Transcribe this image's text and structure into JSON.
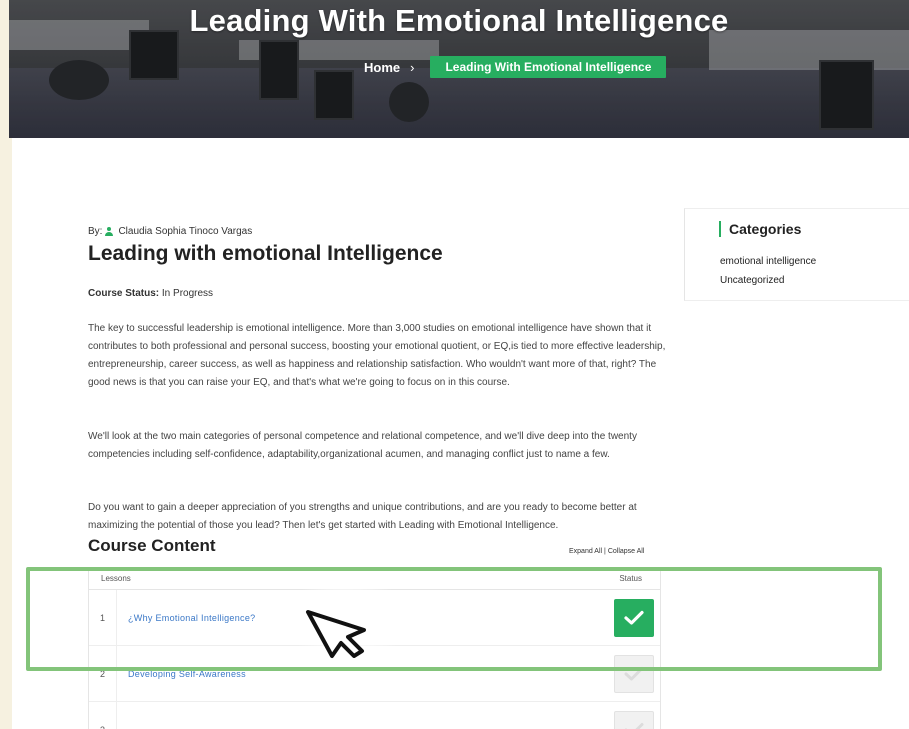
{
  "hero": {
    "title": "Leading With Emotional Intelligence",
    "breadcrumb": {
      "home": "Home",
      "separator": "›",
      "current": "Leading With Emotional Intelligence"
    }
  },
  "course": {
    "by_label": "By:",
    "author": "Claudia Sophia Tinoco Vargas",
    "title": "Leading with emotional Intelligence",
    "status_label": "Course Status:",
    "status_value": "In Progress",
    "paragraphs": [
      "The key to successful leadership is emotional intelligence. More than 3,000 studies on emotional intelligence have shown that it contributes to both professional and personal success, boosting your emotional quotient, or EQ,is tied to more effective leadership, entrepreneurship, career success, as well as happiness and relationship satisfaction. Who wouldn't want more of that, right? The good news is that you can raise your EQ, and that's what we're going to focus on in this course.",
      "We'll look at the two main categories of personal competence and relational competence, and we'll dive deep into the twenty competencies including self-confidence, adaptability,organizational acumen, and managing conflict just to name a few.",
      "Do you want to gain a deeper appreciation of you strengths and unique contributions, and are you ready to become better at maximizing the potential of those you lead? Then let's get started with Leading with Emotional Intelligence."
    ]
  },
  "course_content": {
    "title": "Course Content",
    "expand_all": "Expand All",
    "divider": "|",
    "collapse_all": "Collapse All",
    "headers": {
      "lessons": "Lessons",
      "status": "Status"
    },
    "lessons": [
      {
        "num": "1",
        "title": "¿Why Emotional Intelligence?",
        "completed": true
      },
      {
        "num": "2",
        "title": "Developing Self-Awareness",
        "completed": false
      },
      {
        "num": "3",
        "title": "",
        "completed": false
      }
    ]
  },
  "sidebar": {
    "title": "Categories",
    "items": [
      "emotional intelligence",
      "Uncategorized"
    ]
  },
  "colors": {
    "accent": "#27ae60",
    "highlight": "#83c47a",
    "link": "#3b78c7"
  }
}
